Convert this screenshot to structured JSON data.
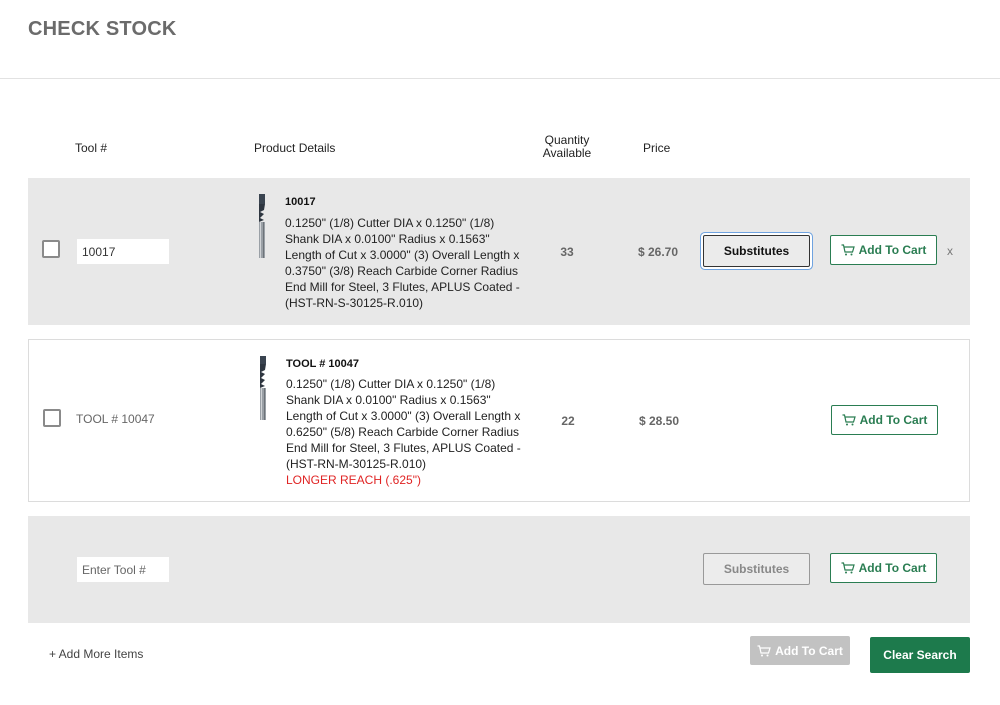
{
  "page": {
    "title": "CHECK STOCK"
  },
  "columns": {
    "tool": "Tool #",
    "details": "Product Details",
    "qty_line1": "Quantity",
    "qty_line2": "Available",
    "price": "Price"
  },
  "rows": [
    {
      "checked": false,
      "tool_value": "10017",
      "name": "10017",
      "description": "0.1250\" (1/8) Cutter DIA x 0.1250\" (1/8) Shank DIA x 0.0100\" Radius x 0.1563\" Length of Cut x 3.0000\" (3) Overall Length x 0.3750\" (3/8) Reach Carbide Corner Radius End Mill for Steel, 3 Flutes, APLUS Coated - (HST-RN-S-30125-R.010)",
      "qty": "33",
      "price": "$ 26.70",
      "substitutes_label": "Substitutes",
      "add_to_cart_label": "Add To Cart",
      "remove_label": "x"
    },
    {
      "checked": false,
      "tool_value": "TOOL # 10047",
      "name": "TOOL # 10047",
      "description": "0.1250\" (1/8) Cutter DIA x 0.1250\" (1/8) Shank DIA x 0.0100\" Radius x 0.1563\" Length of Cut x 3.0000\" (3) Overall Length x 0.6250\" (5/8) Reach Carbide Corner Radius End Mill for Steel, 3 Flutes, APLUS Coated - (HST-RN-M-30125-R.010)",
      "note": "LONGER REACH (.625\")",
      "qty": "22",
      "price": "$ 28.50",
      "add_to_cart_label": "Add To Cart"
    },
    {
      "tool_placeholder": "Enter Tool #",
      "substitutes_label": "Substitutes",
      "add_to_cart_label": "Add To Cart"
    }
  ],
  "footer": {
    "add_more_label": "+ Add More Items",
    "add_to_cart_label": "Add To Cart",
    "clear_search_label": "Clear Search"
  },
  "colors": {
    "accent_green": "#1d7a4c",
    "note_red": "#e02424",
    "row_gray": "#e8e8e8"
  },
  "icons": [
    "cart-icon",
    "end-mill-thumbnail"
  ]
}
